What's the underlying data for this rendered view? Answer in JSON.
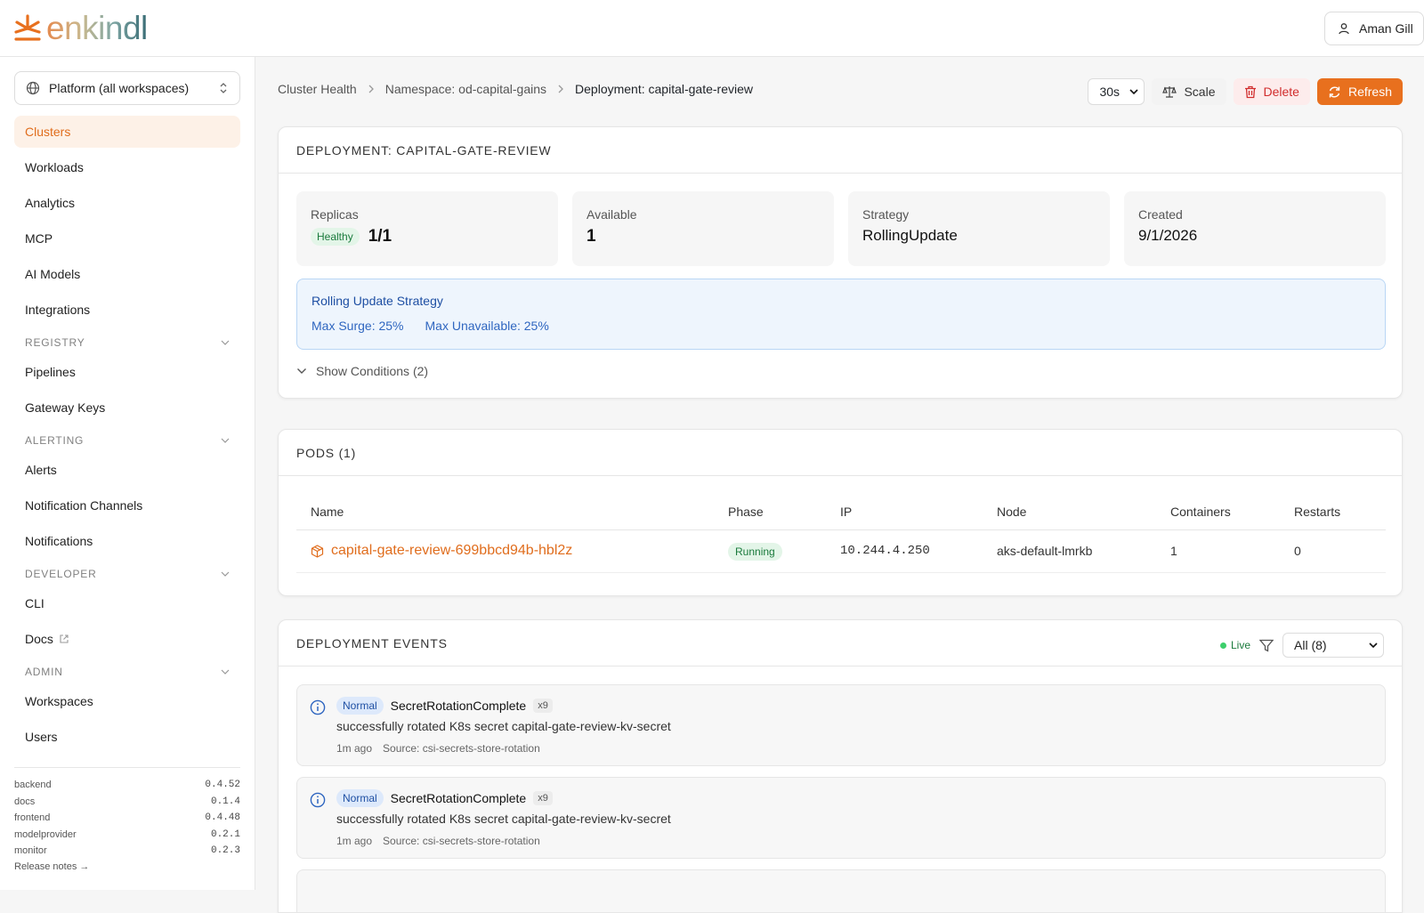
{
  "app": {
    "logo_text": "enkindl"
  },
  "user": {
    "name": "Aman Gill"
  },
  "sidebar": {
    "workspace": "Platform (all workspaces)",
    "items": [
      {
        "label": "Clusters",
        "active": true
      },
      {
        "label": "Workloads"
      },
      {
        "label": "Analytics"
      },
      {
        "label": "MCP"
      },
      {
        "label": "AI Models"
      },
      {
        "label": "Integrations"
      }
    ],
    "registry": {
      "title": "REGISTRY",
      "items": [
        "Pipelines",
        "Gateway Keys"
      ]
    },
    "alerting": {
      "title": "ALERTING",
      "items": [
        "Alerts",
        "Notification Channels",
        "Notifications"
      ]
    },
    "developer": {
      "title": "DEVELOPER",
      "items": [
        "CLI",
        "Docs"
      ]
    },
    "admin": {
      "title": "ADMIN",
      "items": [
        "Workspaces",
        "Users"
      ]
    },
    "versions": [
      {
        "name": "backend",
        "version": "0.4.52"
      },
      {
        "name": "docs",
        "version": "0.1.4"
      },
      {
        "name": "frontend",
        "version": "0.4.48"
      },
      {
        "name": "modelprovider",
        "version": "0.2.1"
      },
      {
        "name": "monitor",
        "version": "0.2.3"
      }
    ],
    "release_notes": "Release notes →"
  },
  "breadcrumb": {
    "items": [
      "Cluster Health",
      "Namespace: od-capital-gains",
      "Deployment: capital-gate-review"
    ]
  },
  "toolbar": {
    "interval": "30s",
    "scale_label": "Scale",
    "delete_label": "Delete",
    "refresh_label": "Refresh"
  },
  "deployment": {
    "title": "DEPLOYMENT: CAPITAL-GATE-REVIEW",
    "replicas_label": "Replicas",
    "health_badge": "Healthy",
    "replicas": "1/1",
    "available_label": "Available",
    "available": "1",
    "strategy_label": "Strategy",
    "strategy": "RollingUpdate",
    "created_label": "Created",
    "created": "9/1/2026",
    "rolling": {
      "title": "Rolling Update Strategy",
      "max_surge": "Max Surge: 25%",
      "max_unavailable": "Max Unavailable: 25%"
    },
    "show_conditions": "Show Conditions (2)"
  },
  "pods": {
    "title": "PODS (1)",
    "columns": [
      "Name",
      "Phase",
      "IP",
      "Node",
      "Containers",
      "Restarts"
    ],
    "rows": [
      {
        "name": "capital-gate-review-699bbcd94b-hbl2z",
        "phase": "Running",
        "ip": "10.244.4.250",
        "node": "aks-default-lmrkb",
        "containers": "1",
        "restarts": "0"
      }
    ]
  },
  "events": {
    "title": "DEPLOYMENT EVENTS",
    "live_label": "Live",
    "filter_value": "All (8)",
    "items": [
      {
        "type": "Normal",
        "reason": "SecretRotationComplete",
        "count": "x9",
        "message": "successfully rotated K8s secret capital-gate-review-kv-secret",
        "age": "1m ago",
        "source": "Source: csi-secrets-store-rotation"
      },
      {
        "type": "Normal",
        "reason": "SecretRotationComplete",
        "count": "x9",
        "message": "successfully rotated K8s secret capital-gate-review-kv-secret",
        "age": "1m ago",
        "source": "Source: csi-secrets-store-rotation"
      }
    ]
  },
  "colors": {
    "accent": "#e8701e",
    "success": "#1a7a3c",
    "info": "#1e4fa3",
    "danger": "#d12d2d"
  }
}
